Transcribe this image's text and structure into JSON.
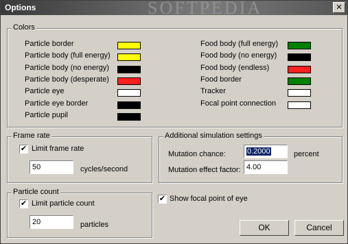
{
  "window": {
    "title": "Options",
    "watermark": "SOFTPEDIA",
    "close_glyph": "✕"
  },
  "colors": {
    "legend": "Colors",
    "left": [
      {
        "label": "Particle border",
        "color": "#ffff00"
      },
      {
        "label": "Particle body (full energy)",
        "color": "#ffff00"
      },
      {
        "label": "Particle body (no energy)",
        "color": "#000000"
      },
      {
        "label": "Particle body (desperate)",
        "color": "#ff2020"
      },
      {
        "label": "Particle eye",
        "color": "#ffffff"
      },
      {
        "label": "Particle eye border",
        "color": "#000000"
      },
      {
        "label": "Particle pupil",
        "color": "#000000"
      }
    ],
    "right": [
      {
        "label": "Food body (full energy)",
        "color": "#008000"
      },
      {
        "label": "Food body (no energy)",
        "color": "#000000"
      },
      {
        "label": "Food body (endless)",
        "color": "#ff2020"
      },
      {
        "label": "Food border",
        "color": "#008000"
      },
      {
        "label": "Tracker",
        "color": "#ffffff"
      },
      {
        "label": "Focal point connection",
        "color": "#ffffff"
      }
    ]
  },
  "frame_rate": {
    "legend": "Frame rate",
    "limit_label": "Limit frame rate",
    "limit_checked": true,
    "value": "50",
    "unit": "cycles/second"
  },
  "simulation": {
    "legend": "Additional simulation settings",
    "mutation_chance_label": "Mutation chance:",
    "mutation_chance_value": "0.2000",
    "mutation_chance_unit": "percent",
    "mutation_effect_label": "Mutation effect factor:",
    "mutation_effect_value": "4.00"
  },
  "particle_count": {
    "legend": "Particle count",
    "limit_label": "Limit particle count",
    "limit_checked": true,
    "value": "20",
    "unit": "particles"
  },
  "focal": {
    "label": "Show focal point of eye",
    "checked": true
  },
  "buttons": {
    "ok": "OK",
    "cancel": "Cancel"
  },
  "check_glyph": "✔"
}
